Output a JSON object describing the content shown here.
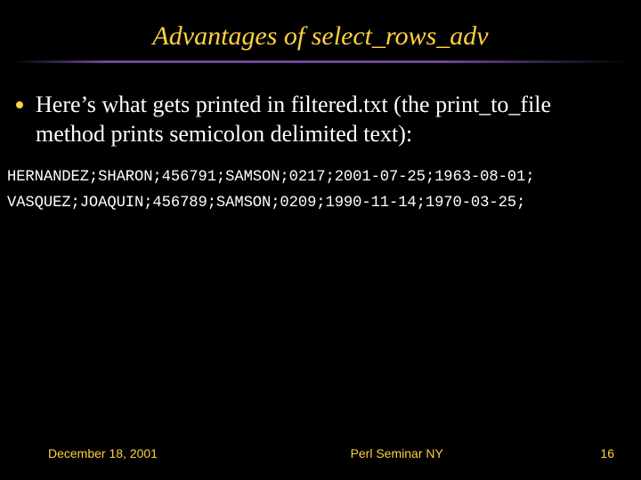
{
  "title": "Advantages of select_rows_adv",
  "bullet": "Here’s what gets printed in filtered.txt  (the print_to_file method prints semicolon delimited text):",
  "code_lines": {
    "l0": "HERNANDEZ;SHARON;456791;SAMSON;0217;2001-07-25;1963-08-01;",
    "l1": "VASQUEZ;JOAQUIN;456789;SAMSON;0209;1990-11-14;1970-03-25;"
  },
  "footer": {
    "date": "December 18, 2001",
    "center": "Perl Seminar NY",
    "page": "16"
  }
}
